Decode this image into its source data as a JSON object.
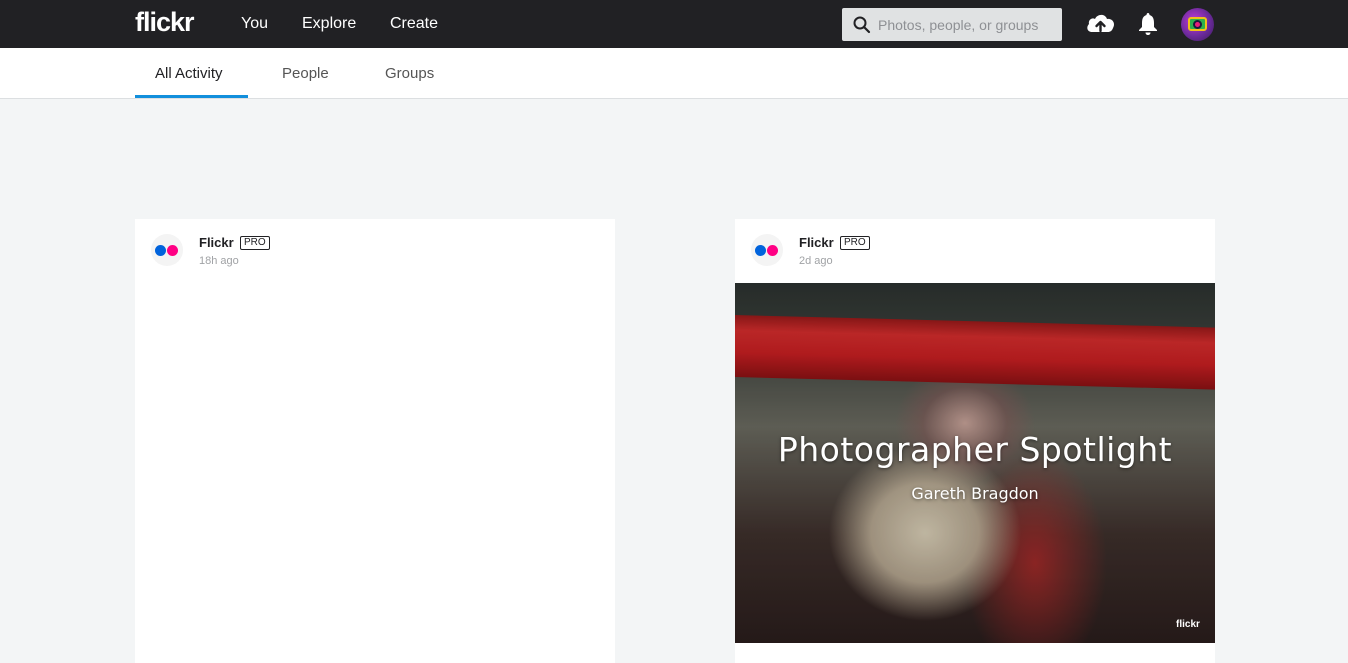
{
  "header": {
    "logo": "flickr",
    "nav": {
      "you": "You",
      "explore": "Explore",
      "create": "Create"
    },
    "search": {
      "placeholder": "Photos, people, or groups"
    },
    "icons": [
      "search-icon",
      "upload-cloud-icon",
      "notification-bell-icon",
      "avatar"
    ]
  },
  "subnav": {
    "tabs": [
      {
        "label": "All Activity",
        "active": true
      },
      {
        "label": "People",
        "active": false
      },
      {
        "label": "Groups",
        "active": false
      }
    ]
  },
  "feed": [
    {
      "author": "Flickr",
      "badge": "PRO",
      "time": "18h ago"
    },
    {
      "author": "Flickr",
      "badge": "PRO",
      "time": "2d ago",
      "image": {
        "title": "Photographer Spotlight",
        "subtitle": "Gareth Bragdon",
        "brand": "flickr"
      }
    }
  ],
  "colors": {
    "topbar": "#212124",
    "accent": "#128fdc",
    "dot_blue": "#0063dc",
    "dot_pink": "#ff0084"
  }
}
